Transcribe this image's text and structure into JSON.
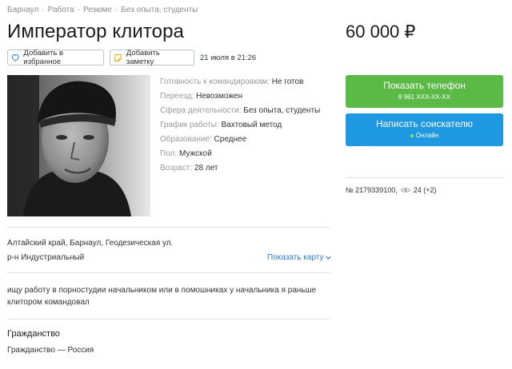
{
  "breadcrumb": {
    "items": [
      "Барнаул",
      "Работа",
      "Резюме",
      "Без опыта, студенты"
    ],
    "separator": "·"
  },
  "title": "Император клитора",
  "price": "60 000 ₽",
  "actions": {
    "favorite_label": "Добавить в избранное",
    "note_label": "Добавить заметку",
    "date": "21 июля в 21:26"
  },
  "details": [
    {
      "key": "Готовность к командировкам:",
      "value": "Не готов"
    },
    {
      "key": "Переезд:",
      "value": "Невозможен"
    },
    {
      "key": "Сфера деятельности:",
      "value": "Без опыта, студенты"
    },
    {
      "key": "График работы:",
      "value": "Вахтовый метод"
    },
    {
      "key": "Образование:",
      "value": "Среднее"
    },
    {
      "key": "Пол:",
      "value": "Мужской"
    },
    {
      "key": "Возраст:",
      "value": "28 лет"
    }
  ],
  "contact": {
    "phone_label": "Показать телефон",
    "phone_masked": "8 961 XXX-XX-XX",
    "message_label": "Написать соискателю",
    "status": "Онлайн"
  },
  "ad_meta": {
    "number": "№ 2179339100,",
    "views": "24 (+2)"
  },
  "location": {
    "address": "Алтайский край, Барнаул, Геодезическая ул.",
    "district": "р-н Индустриальный",
    "map_link": "Показать карту"
  },
  "description": "ищу работу в порностудии начальником или в помошниках у начальника я раньше клитором командовал",
  "citizenship": {
    "title": "Гражданство",
    "value": "Гражданство — Россия"
  },
  "colors": {
    "green_button": "#5bb946",
    "blue_button": "#1e98e0",
    "link": "#2f7bd8",
    "label_gray": "#9a9a9a"
  }
}
